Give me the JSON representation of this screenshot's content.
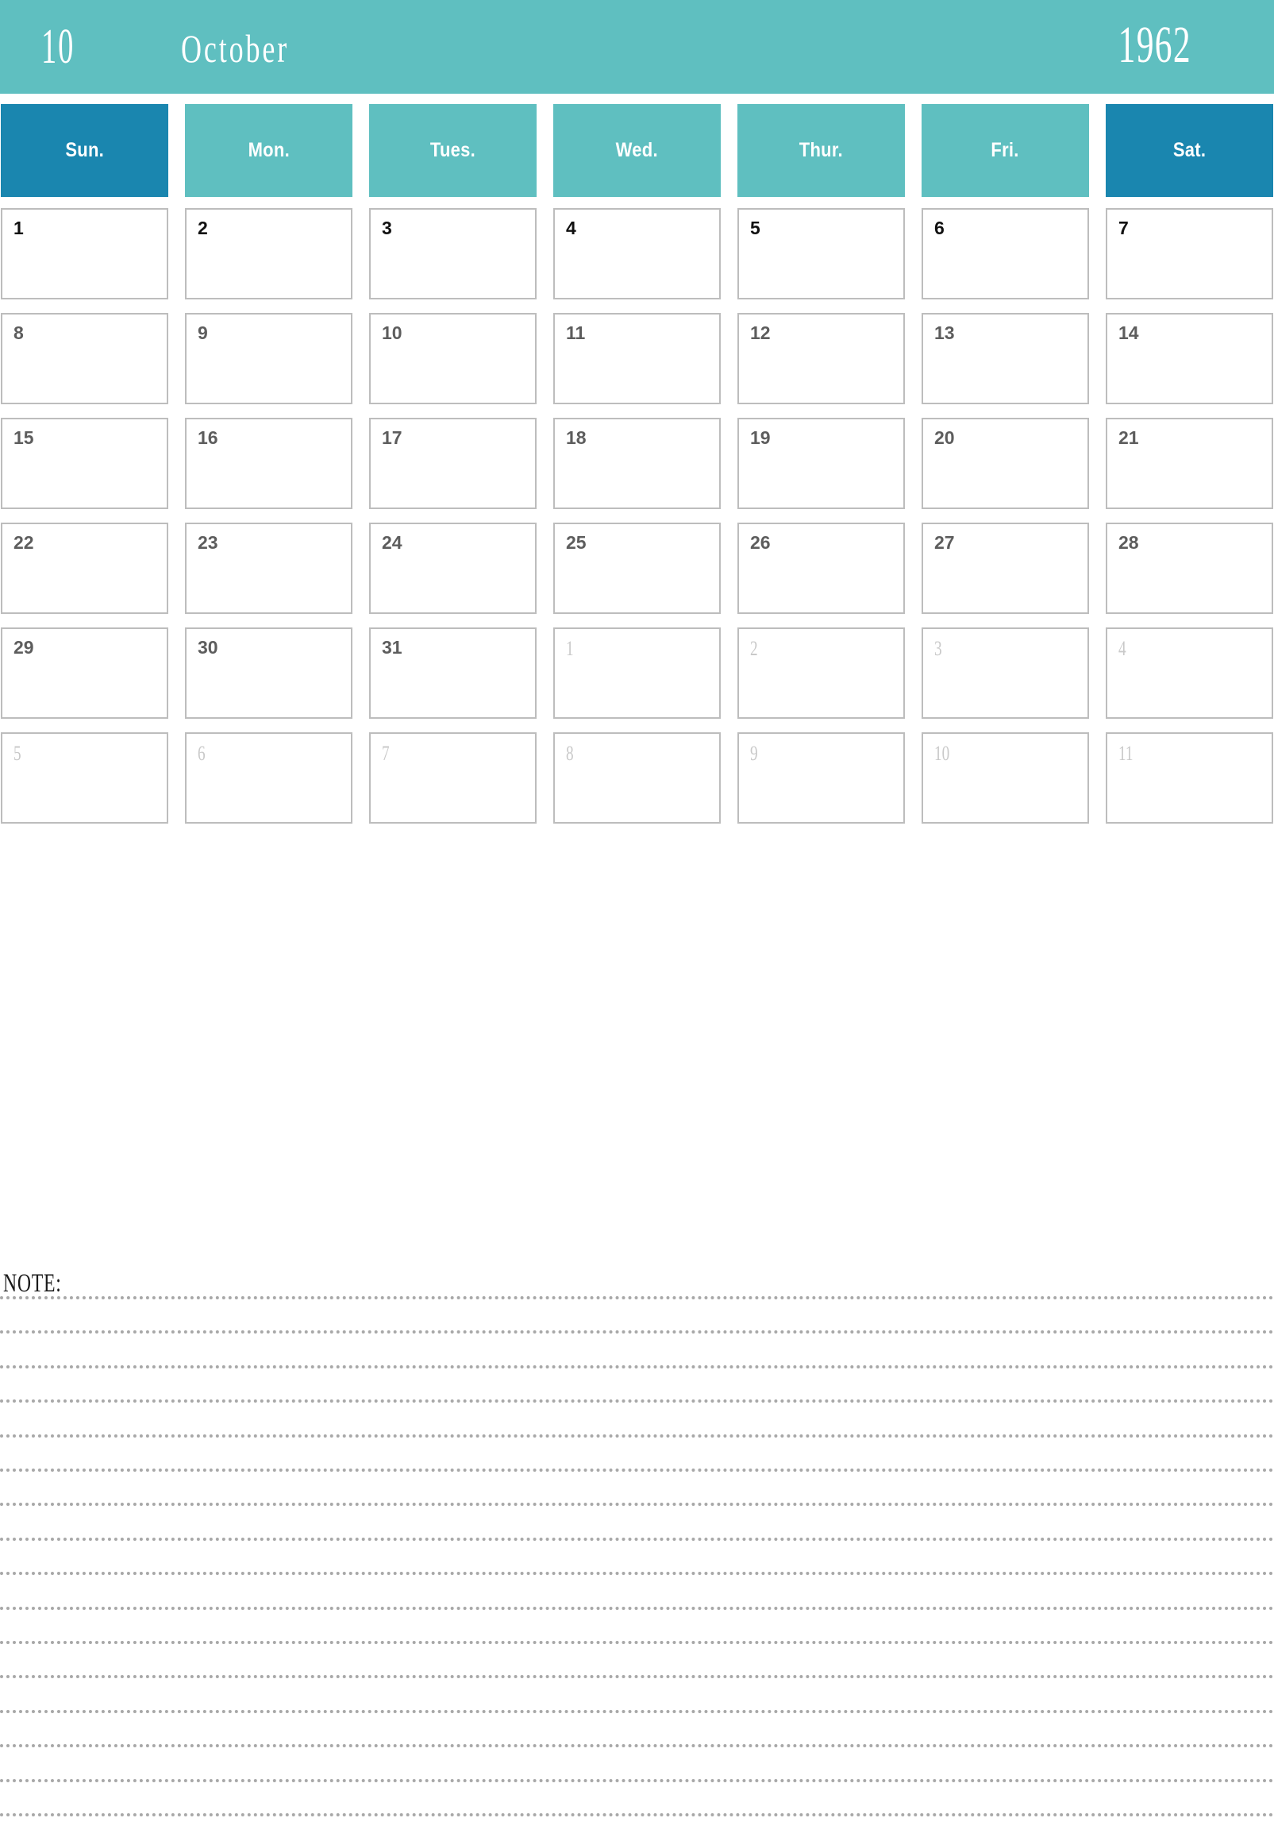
{
  "header": {
    "month_number": "10",
    "month_name": "October",
    "year": "1962",
    "background_color": "#5fbfc0",
    "text_color": "#ffffff"
  },
  "weekdays": [
    {
      "label": "Sun.",
      "weekend": true,
      "color": "#1a86af"
    },
    {
      "label": "Mon.",
      "weekend": false,
      "color": "#5fbfc0"
    },
    {
      "label": "Tues.",
      "weekend": false,
      "color": "#5fbfc0"
    },
    {
      "label": "Wed.",
      "weekend": false,
      "color": "#5fbfc0"
    },
    {
      "label": "Thur.",
      "weekend": false,
      "color": "#5fbfc0"
    },
    {
      "label": "Fri.",
      "weekend": false,
      "color": "#5fbfc0"
    },
    {
      "label": "Sat.",
      "weekend": true,
      "color": "#1a86af"
    }
  ],
  "grid": {
    "rows": 6,
    "columns": 7,
    "cell_border_color": "#bdbdbd",
    "current_month_text_color": "#5d5d5d",
    "other_month_text_color": "#c9c9c9"
  },
  "days": [
    {
      "num": "1",
      "current": true
    },
    {
      "num": "2",
      "current": true
    },
    {
      "num": "3",
      "current": true
    },
    {
      "num": "4",
      "current": true
    },
    {
      "num": "5",
      "current": true
    },
    {
      "num": "6",
      "current": true
    },
    {
      "num": "7",
      "current": true
    },
    {
      "num": "8",
      "current": true
    },
    {
      "num": "9",
      "current": true
    },
    {
      "num": "10",
      "current": true
    },
    {
      "num": "11",
      "current": true
    },
    {
      "num": "12",
      "current": true
    },
    {
      "num": "13",
      "current": true
    },
    {
      "num": "14",
      "current": true
    },
    {
      "num": "15",
      "current": true
    },
    {
      "num": "16",
      "current": true
    },
    {
      "num": "17",
      "current": true
    },
    {
      "num": "18",
      "current": true
    },
    {
      "num": "19",
      "current": true
    },
    {
      "num": "20",
      "current": true
    },
    {
      "num": "21",
      "current": true
    },
    {
      "num": "22",
      "current": true
    },
    {
      "num": "23",
      "current": true
    },
    {
      "num": "24",
      "current": true
    },
    {
      "num": "25",
      "current": true
    },
    {
      "num": "26",
      "current": true
    },
    {
      "num": "27",
      "current": true
    },
    {
      "num": "28",
      "current": true
    },
    {
      "num": "29",
      "current": true
    },
    {
      "num": "30",
      "current": true
    },
    {
      "num": "31",
      "current": true
    },
    {
      "num": "1",
      "current": false
    },
    {
      "num": "2",
      "current": false
    },
    {
      "num": "3",
      "current": false
    },
    {
      "num": "4",
      "current": false
    },
    {
      "num": "5",
      "current": false
    },
    {
      "num": "6",
      "current": false
    },
    {
      "num": "7",
      "current": false
    },
    {
      "num": "8",
      "current": false
    },
    {
      "num": "9",
      "current": false
    },
    {
      "num": "10",
      "current": false
    },
    {
      "num": "11",
      "current": false
    }
  ],
  "notes": {
    "label": "NOTE:",
    "line_count": 16,
    "line_color": "#a8a8a8"
  }
}
